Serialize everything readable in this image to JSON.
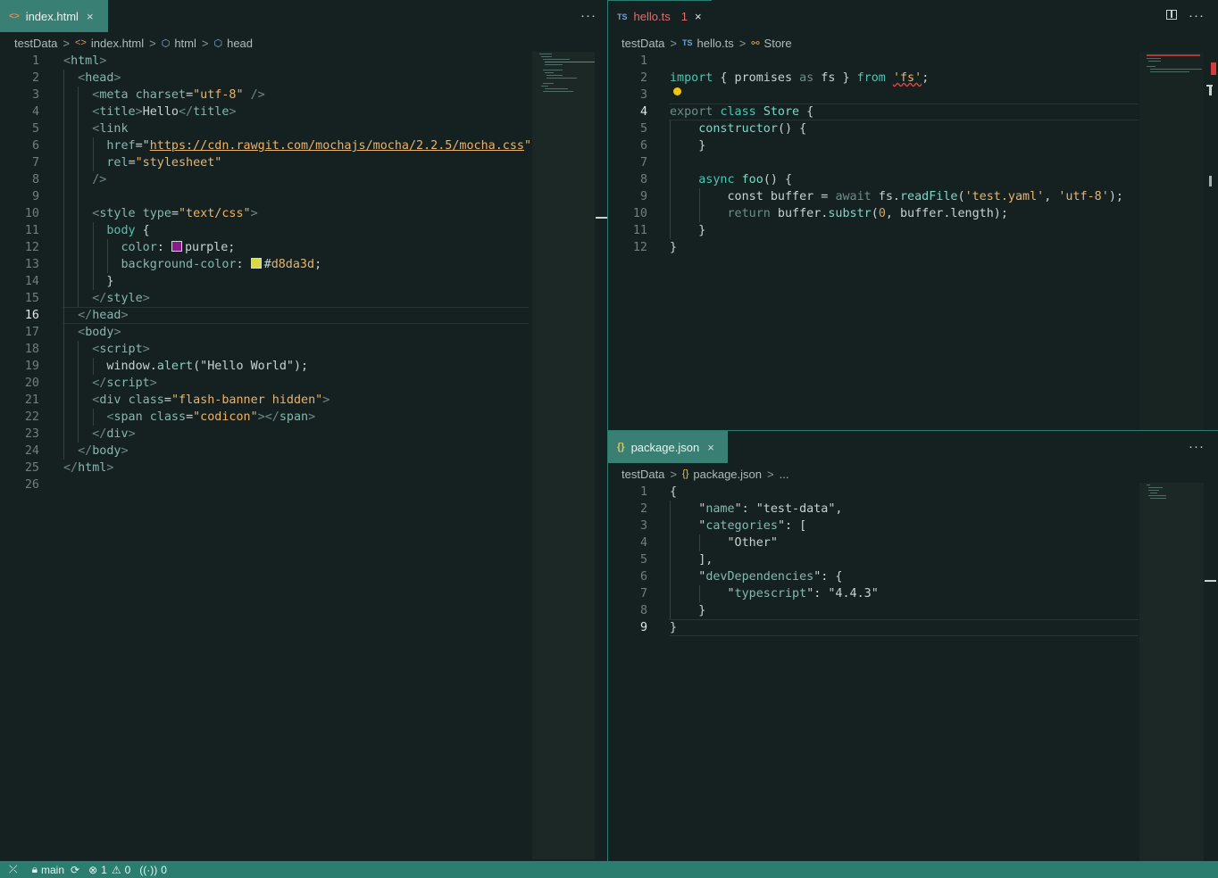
{
  "left_editor": {
    "tab": {
      "label": "index.html",
      "icon": "<>"
    },
    "breadcrumb": [
      "testData",
      "index.html",
      "html",
      "head"
    ],
    "active_line": 16,
    "lines": [
      {
        "n": "1",
        "t": [
          [
            "tg",
            "<"
          ],
          [
            "tn",
            "html"
          ],
          [
            "tg",
            ">"
          ]
        ]
      },
      {
        "n": "2",
        "t": [
          [
            "",
            "  "
          ],
          [
            "tg",
            "<"
          ],
          [
            "tn",
            "head"
          ],
          [
            "tg",
            ">"
          ]
        ]
      },
      {
        "n": "3",
        "t": [
          [
            "",
            "    "
          ],
          [
            "tg",
            "<"
          ],
          [
            "tn",
            "meta "
          ],
          [
            "at",
            "charset"
          ],
          [
            "",
            "="
          ],
          [
            "st",
            "\"utf-8\""
          ],
          [
            "tg",
            " />"
          ]
        ]
      },
      {
        "n": "4",
        "t": [
          [
            "",
            "    "
          ],
          [
            "tg",
            "<"
          ],
          [
            "tn",
            "title"
          ],
          [
            "tg",
            ">"
          ],
          [
            "",
            "Hello"
          ],
          [
            "tg",
            "</"
          ],
          [
            "tn",
            "title"
          ],
          [
            "tg",
            ">"
          ]
        ]
      },
      {
        "n": "5",
        "t": [
          [
            "",
            "    "
          ],
          [
            "tg",
            "<"
          ],
          [
            "tn",
            "link"
          ]
        ]
      },
      {
        "n": "6",
        "t": [
          [
            "",
            "      "
          ],
          [
            "at",
            "href"
          ],
          [
            "",
            "=\""
          ],
          [
            "st ul",
            "https://cdn.rawgit.com/mochajs/mocha/2.2.5/mocha.css"
          ],
          [
            "st",
            "\""
          ]
        ]
      },
      {
        "n": "7",
        "t": [
          [
            "",
            "      "
          ],
          [
            "at",
            "rel"
          ],
          [
            "",
            "="
          ],
          [
            "st",
            "\"stylesheet\""
          ]
        ]
      },
      {
        "n": "8",
        "t": [
          [
            "",
            "    "
          ],
          [
            "tg",
            "/>"
          ]
        ]
      },
      {
        "n": "9",
        "t": []
      },
      {
        "n": "10",
        "t": [
          [
            "",
            "    "
          ],
          [
            "tg",
            "<"
          ],
          [
            "tn",
            "style "
          ],
          [
            "at",
            "type"
          ],
          [
            "",
            "="
          ],
          [
            "st",
            "\"text/css\""
          ],
          [
            "tg",
            ">"
          ]
        ]
      },
      {
        "n": "11",
        "t": [
          [
            "",
            "      "
          ],
          [
            "kw",
            "body"
          ],
          [
            "",
            " {"
          ]
        ]
      },
      {
        "n": "12",
        "t": [
          [
            "",
            "        "
          ],
          [
            "pr",
            "color"
          ],
          [
            "",
            ": "
          ],
          [
            "swp",
            ""
          ],
          [
            "",
            "purple;"
          ]
        ]
      },
      {
        "n": "13",
        "t": [
          [
            "",
            "        "
          ],
          [
            "pr",
            "background-color"
          ],
          [
            "",
            ": "
          ],
          [
            "swy",
            ""
          ],
          [
            "",
            "#"
          ],
          [
            "st",
            "d8da3d"
          ],
          [
            "",
            ";"
          ]
        ]
      },
      {
        "n": "14",
        "t": [
          [
            "",
            "      }"
          ]
        ]
      },
      {
        "n": "15",
        "t": [
          [
            "",
            "    "
          ],
          [
            "tg",
            "</"
          ],
          [
            "tn",
            "style"
          ],
          [
            "tg",
            ">"
          ]
        ]
      },
      {
        "n": "16",
        "t": [
          [
            "",
            "  "
          ],
          [
            "tg",
            "</"
          ],
          [
            "tn",
            "head"
          ],
          [
            "tg",
            ">"
          ]
        ]
      },
      {
        "n": "17",
        "t": [
          [
            "",
            "  "
          ],
          [
            "tg",
            "<"
          ],
          [
            "tn",
            "body"
          ],
          [
            "tg",
            ">"
          ]
        ]
      },
      {
        "n": "18",
        "t": [
          [
            "",
            "    "
          ],
          [
            "tg",
            "<"
          ],
          [
            "tn",
            "script"
          ],
          [
            "tg",
            ">"
          ]
        ]
      },
      {
        "n": "19",
        "t": [
          [
            "",
            "      window."
          ],
          [
            "fn",
            "alert"
          ],
          [
            "",
            "(\"Hello World\");"
          ]
        ]
      },
      {
        "n": "20",
        "t": [
          [
            "",
            "    "
          ],
          [
            "tg",
            "</"
          ],
          [
            "tn",
            "script"
          ],
          [
            "tg",
            ">"
          ]
        ]
      },
      {
        "n": "21",
        "t": [
          [
            "",
            "    "
          ],
          [
            "tg",
            "<"
          ],
          [
            "tn",
            "div "
          ],
          [
            "at",
            "class"
          ],
          [
            "",
            "="
          ],
          [
            "st",
            "\"flash-banner hidden\""
          ],
          [
            "tg",
            ">"
          ]
        ]
      },
      {
        "n": "22",
        "t": [
          [
            "",
            "      "
          ],
          [
            "tg",
            "<"
          ],
          [
            "tn",
            "span "
          ],
          [
            "at",
            "class"
          ],
          [
            "",
            "="
          ],
          [
            "st",
            "\"codicon\""
          ],
          [
            "tg",
            "></"
          ],
          [
            "tn",
            "span"
          ],
          [
            "tg",
            ">"
          ]
        ]
      },
      {
        "n": "23",
        "t": [
          [
            "",
            "    "
          ],
          [
            "tg",
            "</"
          ],
          [
            "tn",
            "div"
          ],
          [
            "tg",
            ">"
          ]
        ]
      },
      {
        "n": "24",
        "t": [
          [
            "",
            "  "
          ],
          [
            "tg",
            "</"
          ],
          [
            "tn",
            "body"
          ],
          [
            "tg",
            ">"
          ]
        ]
      },
      {
        "n": "25",
        "t": [
          [
            "tg",
            "</"
          ],
          [
            "tn",
            "html"
          ],
          [
            "tg",
            ">"
          ]
        ]
      },
      {
        "n": "26",
        "t": []
      }
    ],
    "swatch_colors": {
      "purple": "#8b1c8b",
      "yellow": "#d8da3d"
    }
  },
  "right_top_editor": {
    "tab": {
      "label": "hello.ts",
      "icon": "TS",
      "problems": "1"
    },
    "breadcrumb": [
      "testData",
      "hello.ts",
      "Store"
    ],
    "active_line": 4,
    "lines": [
      {
        "n": "1",
        "t": []
      },
      {
        "n": "2",
        "t": [
          [
            "kw",
            "import"
          ],
          [
            "",
            " { promises "
          ],
          [
            "dm",
            "as"
          ],
          [
            "",
            " fs } "
          ],
          [
            "kw",
            "from"
          ],
          [
            "",
            " "
          ],
          [
            "st sq",
            "'fs'"
          ],
          [
            "",
            ";"
          ]
        ]
      },
      {
        "n": "3",
        "t": []
      },
      {
        "n": "4",
        "t": [
          [
            "dm",
            "export"
          ],
          [
            "",
            " "
          ],
          [
            "kw",
            "class"
          ],
          [
            "",
            " "
          ],
          [
            "fn",
            "Store"
          ],
          [
            "",
            " {"
          ]
        ]
      },
      {
        "n": "5",
        "t": [
          [
            "",
            "    "
          ],
          [
            "fn",
            "constructor"
          ],
          [
            "",
            "() {"
          ]
        ]
      },
      {
        "n": "6",
        "t": [
          [
            "",
            "    }"
          ]
        ]
      },
      {
        "n": "7",
        "t": []
      },
      {
        "n": "8",
        "t": [
          [
            "",
            "    "
          ],
          [
            "kw",
            "async"
          ],
          [
            "",
            " "
          ],
          [
            "fn",
            "foo"
          ],
          [
            "",
            "() {"
          ]
        ]
      },
      {
        "n": "9",
        "t": [
          [
            "",
            "        "
          ],
          [
            "",
            "const"
          ],
          [
            "",
            " buffer = "
          ],
          [
            "dm",
            "await"
          ],
          [
            "",
            " fs."
          ],
          [
            "fn",
            "readFile"
          ],
          [
            "",
            "("
          ],
          [
            "st",
            "'test.yaml'"
          ],
          [
            "",
            ", "
          ],
          [
            "st",
            "'utf-8'"
          ],
          [
            "",
            ");"
          ]
        ]
      },
      {
        "n": "10",
        "t": [
          [
            "",
            "        "
          ],
          [
            "dm",
            "return"
          ],
          [
            "",
            " buffer."
          ],
          [
            "fn",
            "substr"
          ],
          [
            "",
            "("
          ],
          [
            "nm",
            "0"
          ],
          [
            "",
            ", buffer.length);"
          ]
        ]
      },
      {
        "n": "11",
        "t": [
          [
            "",
            "    }"
          ]
        ]
      },
      {
        "n": "12",
        "t": [
          [
            "",
            "}"
          ]
        ]
      }
    ]
  },
  "right_bottom_editor": {
    "tab": {
      "label": "package.json",
      "icon": "{}"
    },
    "breadcrumb": [
      "testData",
      "package.json",
      "..."
    ],
    "active_line": 9,
    "lines": [
      {
        "n": "1",
        "t": [
          [
            "",
            "{"
          ]
        ]
      },
      {
        "n": "2",
        "t": [
          [
            "",
            "    \""
          ],
          [
            "pr",
            "name"
          ],
          [
            "",
            "\": \"test-data\","
          ]
        ]
      },
      {
        "n": "3",
        "t": [
          [
            "",
            "    \""
          ],
          [
            "pr",
            "categories"
          ],
          [
            "",
            "\": ["
          ]
        ]
      },
      {
        "n": "4",
        "t": [
          [
            "",
            "        \"Other\""
          ]
        ]
      },
      {
        "n": "5",
        "t": [
          [
            "",
            "    ],"
          ]
        ]
      },
      {
        "n": "6",
        "t": [
          [
            "",
            "    \""
          ],
          [
            "pr",
            "devDependencies"
          ],
          [
            "",
            "\": {"
          ]
        ]
      },
      {
        "n": "7",
        "t": [
          [
            "",
            "        \""
          ],
          [
            "pr",
            "typescript"
          ],
          [
            "",
            "\": \"4.4.3\""
          ]
        ]
      },
      {
        "n": "8",
        "t": [
          [
            "",
            "    }"
          ]
        ]
      },
      {
        "n": "9",
        "t": [
          [
            "",
            "}"
          ]
        ]
      }
    ]
  },
  "status_bar": {
    "branch": "main",
    "errors": "1",
    "warnings": "0",
    "ports": "0"
  },
  "icons": {
    "more": "···",
    "close": "×",
    "chevron": ">",
    "split": "split-editor-icon"
  },
  "colors": {
    "background": "#152120",
    "active_tab": "#3a7f74",
    "status_bar": "#2b7e6f",
    "string": "#e9b36d",
    "keyword": "#4fc3b1",
    "error": "#e04848"
  }
}
